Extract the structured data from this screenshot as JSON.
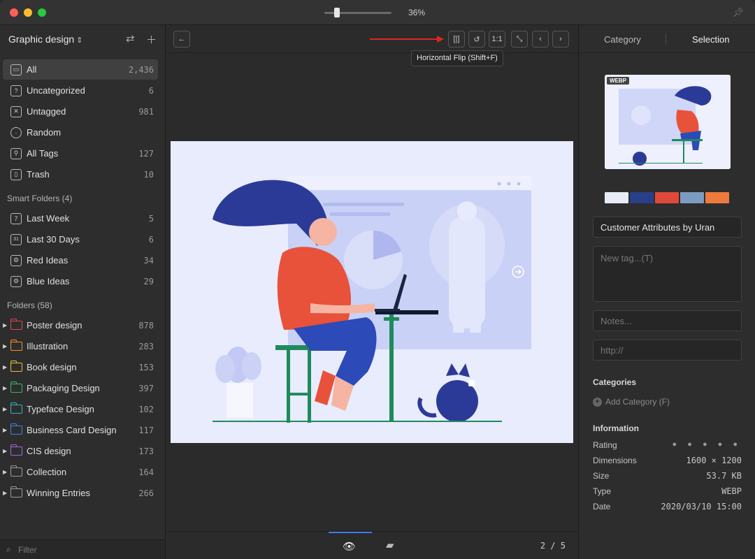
{
  "titlebar": {
    "zoom_label": "36%"
  },
  "sidebar": {
    "library_name": "Graphic design",
    "library_chevron": "⌃",
    "top_items": [
      {
        "label": "All",
        "count": "2,436"
      },
      {
        "label": "Uncategorized",
        "count": "6"
      },
      {
        "label": "Untagged",
        "count": "981"
      },
      {
        "label": "Random",
        "count": ""
      },
      {
        "label": "All Tags",
        "count": "127"
      },
      {
        "label": "Trash",
        "count": "10"
      }
    ],
    "smart_title": "Smart Folders (4)",
    "smart_items": [
      {
        "label": "Last Week",
        "count": "5",
        "icon_text": "7"
      },
      {
        "label": "Last 30 Days",
        "count": "6",
        "icon_text": "31"
      },
      {
        "label": "Red Ideas",
        "count": "34"
      },
      {
        "label": "Blue Ideas",
        "count": "29"
      }
    ],
    "folders_title": "Folders (58)",
    "folders": [
      {
        "label": "Poster design",
        "count": "878",
        "color": "#e0454e"
      },
      {
        "label": "Illustration",
        "count": "283",
        "color": "#f0932e"
      },
      {
        "label": "Book design",
        "count": "153",
        "color": "#e6c332"
      },
      {
        "label": "Packaging Design",
        "count": "397",
        "color": "#35b864"
      },
      {
        "label": "Typeface Design",
        "count": "102",
        "color": "#2fb7c2"
      },
      {
        "label": "Business Card Design",
        "count": "117",
        "color": "#3f84e5"
      },
      {
        "label": "CIS design",
        "count": "173",
        "color": "#a06ad6"
      },
      {
        "label": "Collection",
        "count": "164",
        "color": "#9a9a9a"
      },
      {
        "label": "Winning Entries",
        "count": "266",
        "color": "#9a9a9a"
      }
    ],
    "filter_placeholder": "Filter"
  },
  "toolbar": {
    "one_to_one_label": "1:1",
    "tooltip": "Horizontal Flip (Shift+F)"
  },
  "viewer": {
    "pager": "2 / 5"
  },
  "right": {
    "tab_category": "Category",
    "tab_selection": "Selection",
    "badge": "WEBP",
    "palette": [
      "#e8ecf6",
      "#2a3f8a",
      "#e0493a",
      "#7d9bc1",
      "#ee7a3e"
    ],
    "title_value": "Customer Attributes by Uran",
    "tag_placeholder": "New tag...(T)",
    "notes_placeholder": "Notes...",
    "url_placeholder": "http://",
    "categories_title": "Categories",
    "add_category": "Add Category (F)",
    "information_title": "Information",
    "info": {
      "rating_label": "Rating",
      "rating": "● ● ● ● ●",
      "dimensions_label": "Dimensions",
      "dimensions": "1600 × 1200",
      "size_label": "Size",
      "size": "53.7 KB",
      "type_label": "Type",
      "type": "WEBP",
      "date_label": "Date",
      "date": "2020/03/10 15:00"
    }
  }
}
